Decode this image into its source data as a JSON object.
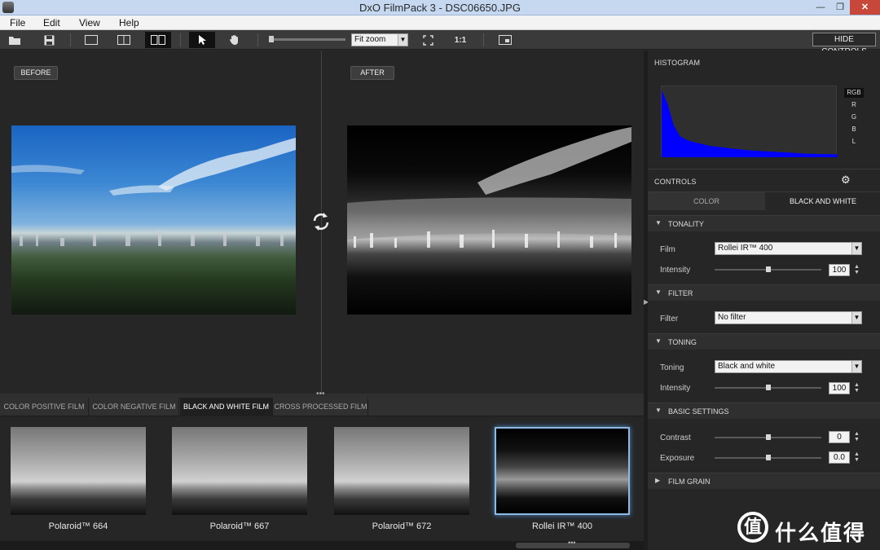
{
  "window": {
    "title": "DxO FilmPack 3 - DSC06650.JPG",
    "min": "—",
    "max": "❐",
    "close": "✕"
  },
  "menu": [
    "File",
    "Edit",
    "View",
    "Help"
  ],
  "toolbar": {
    "zoom_value": "Fit zoom",
    "one_to_one": "1:1",
    "hide_controls": "HIDE CONTROLS"
  },
  "preview": {
    "before_label": "BEFORE",
    "after_label": "AFTER",
    "splitter": "•••"
  },
  "film_tabs": [
    {
      "label": "COLOR POSITIVE FILM",
      "active": false
    },
    {
      "label": "COLOR NEGATIVE FILM",
      "active": false
    },
    {
      "label": "BLACK AND WHITE FILM",
      "active": true
    },
    {
      "label": "CROSS PROCESSED FILM",
      "active": false
    }
  ],
  "thumbnails": [
    {
      "label": "Polaroid™ 664",
      "selected": false
    },
    {
      "label": "Polaroid™ 667",
      "selected": false
    },
    {
      "label": "Polaroid™ 672",
      "selected": false
    },
    {
      "label": "Rollei IR™ 400",
      "selected": true
    }
  ],
  "scroll_dots": "•••",
  "histogram": {
    "title": "HISTOGRAM",
    "channels": [
      "RGB",
      "R",
      "G",
      "B",
      "L"
    ],
    "active_channel": "RGB",
    "color": "#0000ff",
    "levels": [
      0.95,
      0.75,
      0.45,
      0.3,
      0.25,
      0.22,
      0.2,
      0.18,
      0.16,
      0.15,
      0.14,
      0.13,
      0.12,
      0.11,
      0.1,
      0.095,
      0.09,
      0.085,
      0.08,
      0.075,
      0.07,
      0.065,
      0.06,
      0.055,
      0.05,
      0.048,
      0.046,
      0.044,
      0.042,
      0.04
    ]
  },
  "controls": {
    "title": "CONTROLS",
    "tabs": [
      "COLOR",
      "BLACK AND WHITE"
    ],
    "active_tab": "BLACK AND WHITE",
    "tonality": {
      "title": "TONALITY",
      "film_label": "Film",
      "film_value": "Rollei IR™ 400",
      "intensity_label": "Intensity",
      "intensity_value": "100"
    },
    "filter": {
      "title": "FILTER",
      "filter_label": "Filter",
      "filter_value": "No filter"
    },
    "toning": {
      "title": "TONING",
      "toning_label": "Toning",
      "toning_value": "Black and white",
      "intensity_label": "Intensity",
      "intensity_value": "100"
    },
    "basic": {
      "title": "BASIC SETTINGS",
      "contrast_label": "Contrast",
      "contrast_value": "0",
      "exposure_label": "Exposure",
      "exposure_value": "0.0"
    },
    "grain": {
      "title": "FILM GRAIN"
    }
  },
  "watermark": {
    "logo": "值",
    "text": "什么值得买"
  }
}
